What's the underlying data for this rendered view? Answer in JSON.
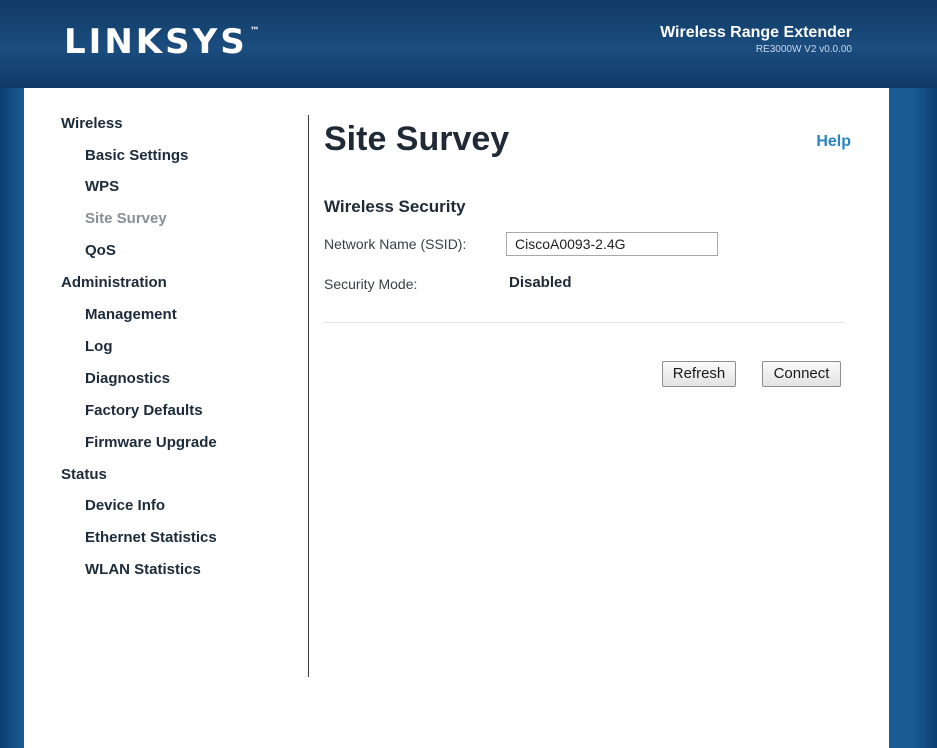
{
  "header": {
    "logo_text": "LINKSYS",
    "logo_tm": "™",
    "product_title": "Wireless Range Extender",
    "product_model": "RE3000W V2 v0.0.00"
  },
  "sidebar": {
    "sections": [
      {
        "label": "Wireless",
        "items": [
          "Basic Settings",
          "WPS",
          "Site Survey",
          "QoS"
        ]
      },
      {
        "label": "Administration",
        "items": [
          "Management",
          "Log",
          "Diagnostics",
          "Factory Defaults",
          "Firmware Upgrade"
        ]
      },
      {
        "label": "Status",
        "items": [
          "Device Info",
          "Ethernet Statistics",
          "WLAN Statistics"
        ]
      }
    ],
    "active_item": "Site Survey"
  },
  "main": {
    "title": "Site Survey",
    "help_label": "Help",
    "section_title": "Wireless Security",
    "ssid_label": "Network Name (SSID):",
    "ssid_value": "CiscoA0093-2.4G",
    "security_label": "Security Mode:",
    "security_value": "Disabled",
    "refresh_label": "Refresh",
    "connect_label": "Connect"
  },
  "colors": {
    "header_bg": "#1b4d7f",
    "side_bg": "#1a5b94",
    "help_link": "#2a83c2",
    "active_nav": "#8a8f96"
  }
}
